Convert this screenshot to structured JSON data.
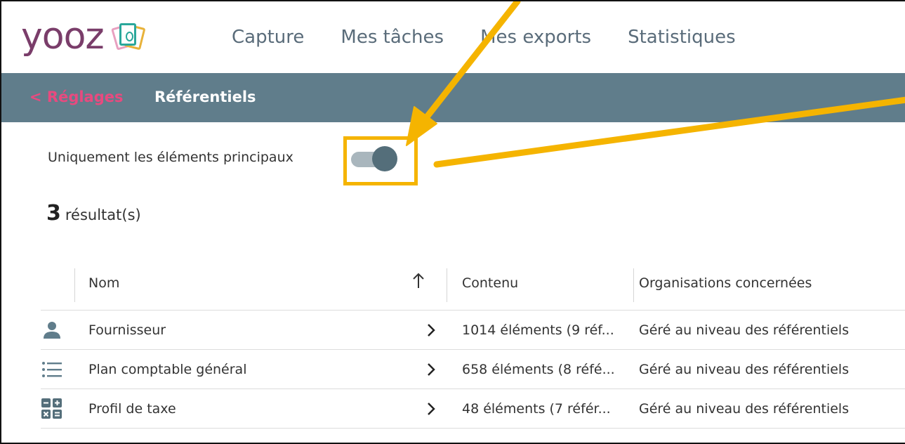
{
  "app": {
    "logo_text": "yooz"
  },
  "nav": {
    "items": [
      {
        "label": "Capture"
      },
      {
        "label": "Mes tâches"
      },
      {
        "label": "Mes exports"
      },
      {
        "label": "Statistiques"
      }
    ]
  },
  "subbar": {
    "back_label": "< Réglages",
    "title": "Référentiels"
  },
  "filter": {
    "toggle_label": "Uniquement les éléments principaux",
    "toggle_on": true
  },
  "results": {
    "count": "3",
    "label": "résultat(s)"
  },
  "table": {
    "columns": {
      "name": "Nom",
      "content": "Contenu",
      "orgs": "Organisations concernées"
    },
    "rows": [
      {
        "icon": "person-icon",
        "name": "Fournisseur",
        "content": "1014 éléments (9 réf...",
        "orgs": "Géré au niveau des référentiels"
      },
      {
        "icon": "list-icon",
        "name": "Plan comptable général",
        "content": "658 éléments (8 réfé...",
        "orgs": "Géré au niveau des référentiels"
      },
      {
        "icon": "calculator-icon",
        "name": "Profil de taxe",
        "content": "48 éléments (7 référ...",
        "orgs": "Géré au niveau des référentiels"
      }
    ]
  },
  "colors": {
    "brand": "#7a3d6a",
    "subbar": "#607d8b",
    "back_link": "#e84a7f",
    "highlight": "#f5b400",
    "toggle_knob": "#546e7a"
  }
}
